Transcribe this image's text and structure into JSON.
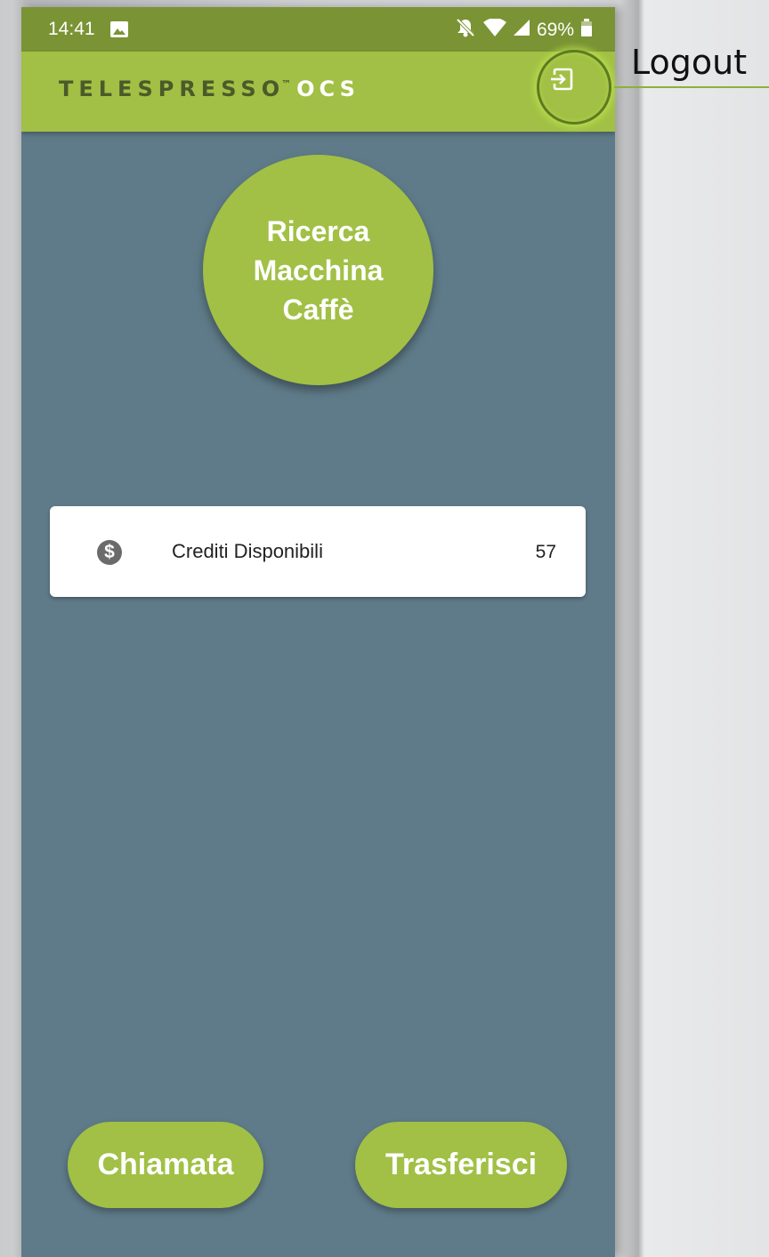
{
  "status_bar": {
    "time": "14:41",
    "battery": "69%"
  },
  "app_bar": {
    "logo_main": "TELESPRESSO",
    "logo_tm": "™",
    "logo_suffix": "OCS"
  },
  "callout": {
    "label": "Logout"
  },
  "main": {
    "search_button": "Ricerca\nMacchina\nCaffè",
    "credits": {
      "icon": "dollar-icon",
      "label": "Crediti Disponibili",
      "value": "57"
    }
  },
  "bottom": {
    "call_button": "Chiamata",
    "transfer_button": "Trasferisci"
  },
  "colors": {
    "accent": "#a1c045",
    "status_bar": "#7a9334",
    "background": "#5f7b89"
  }
}
